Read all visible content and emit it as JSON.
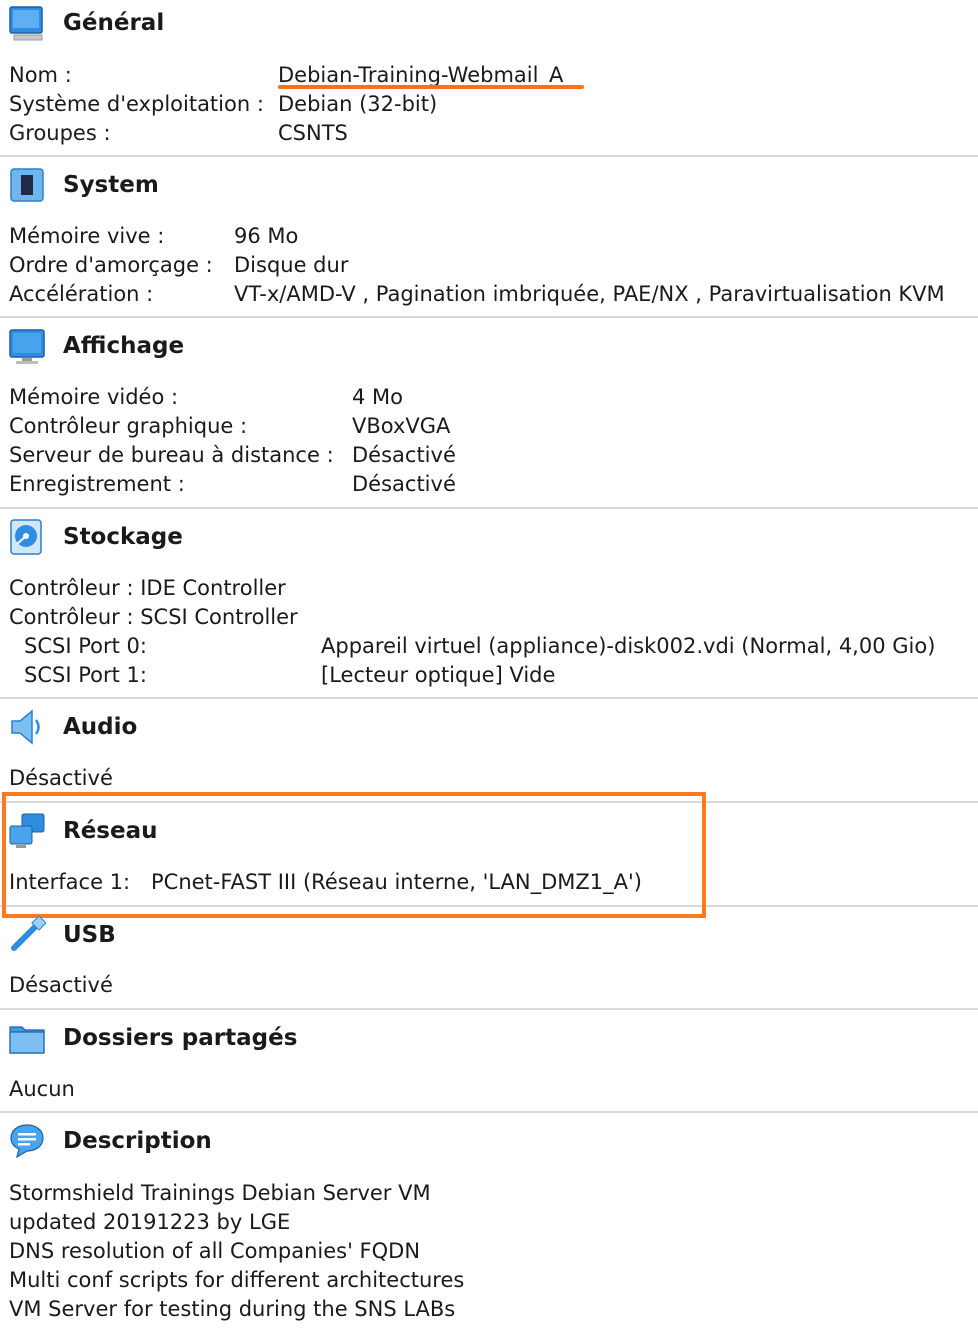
{
  "colors": {
    "accent_orange": "#ff7a1f",
    "separator": "#d9d9d9",
    "icon_blue": "#2e8de0"
  },
  "general": {
    "title": "Général",
    "icon": "monitor-icon",
    "rows": [
      {
        "label": "Nom :",
        "value": "Debian-Training-Webmail_A"
      },
      {
        "label": "Système d'exploitation :",
        "value": "Debian (32-bit)"
      },
      {
        "label": "Groupes :",
        "value": "CSNTS"
      }
    ]
  },
  "system": {
    "title": "System",
    "icon": "chip-icon",
    "rows": [
      {
        "label": "Mémoire vive :",
        "value": "96 Mo"
      },
      {
        "label": "Ordre d'amorçage :",
        "value": "Disque dur"
      },
      {
        "label": "Accélération :",
        "value": "VT-x/AMD-V , Pagination imbriquée, PAE/NX , Paravirtualisation KVM"
      }
    ]
  },
  "display": {
    "title": "Affichage",
    "icon": "display-icon",
    "rows": [
      {
        "label": "Mémoire vidéo :",
        "value": "4 Mo"
      },
      {
        "label": "Contrôleur graphique :",
        "value": "VBoxVGA"
      },
      {
        "label": "Serveur de bureau à distance :",
        "value": "Désactivé"
      },
      {
        "label": "Enregistrement :",
        "value": "Désactivé"
      }
    ]
  },
  "storage": {
    "title": "Stockage",
    "icon": "disk-icon",
    "controllers": [
      "Contrôleur : IDE Controller",
      "Contrôleur : SCSI Controller"
    ],
    "ports": [
      {
        "label": "SCSI Port 0:",
        "value": "Appareil virtuel (appliance)-disk002.vdi (Normal, 4,00 Gio)"
      },
      {
        "label": "SCSI Port 1:",
        "value": "[Lecteur optique] Vide"
      }
    ]
  },
  "audio": {
    "title": "Audio",
    "icon": "speaker-icon",
    "value": "Désactivé"
  },
  "network": {
    "title": "Réseau",
    "icon": "network-icon",
    "interface_label": "Interface 1:",
    "interface_value": "PCnet-FAST III (Réseau interne, 'LAN_DMZ1_A')"
  },
  "usb": {
    "title": "USB",
    "icon": "usb-icon",
    "value": "Désactivé"
  },
  "shared": {
    "title": "Dossiers partagés",
    "icon": "folder-icon",
    "value": "Aucun"
  },
  "description": {
    "title": "Description",
    "icon": "speech-bubble-icon",
    "lines": [
      "Stormshield Trainings Debian Server VM",
      "updated 20191223  by LGE",
      "DNS resolution of all Companies' FQDN",
      "Multi conf scripts for different architectures",
      "VM Server for testing during the SNS LABs"
    ]
  }
}
